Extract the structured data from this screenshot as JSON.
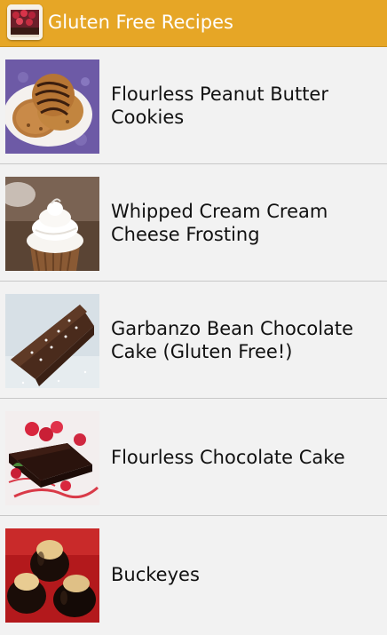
{
  "app": {
    "title": "Gluten Free Recipes",
    "icon": "recipe-app-icon",
    "accent": "#e6a626"
  },
  "recipes": [
    {
      "title": "Flourless Peanut Butter Cookies",
      "thumbnail": "peanut-butter-cookies-photo"
    },
    {
      "title": "Whipped Cream Cream Cheese Frosting",
      "thumbnail": "frosted-cupcake-photo"
    },
    {
      "title": "Garbanzo Bean Chocolate Cake (Gluten Free!)",
      "thumbnail": "chocolate-cake-slice-photo"
    },
    {
      "title": "Flourless Chocolate Cake",
      "thumbnail": "flourless-cake-raspberries-photo"
    },
    {
      "title": "Buckeyes",
      "thumbnail": "buckeyes-photo"
    }
  ]
}
